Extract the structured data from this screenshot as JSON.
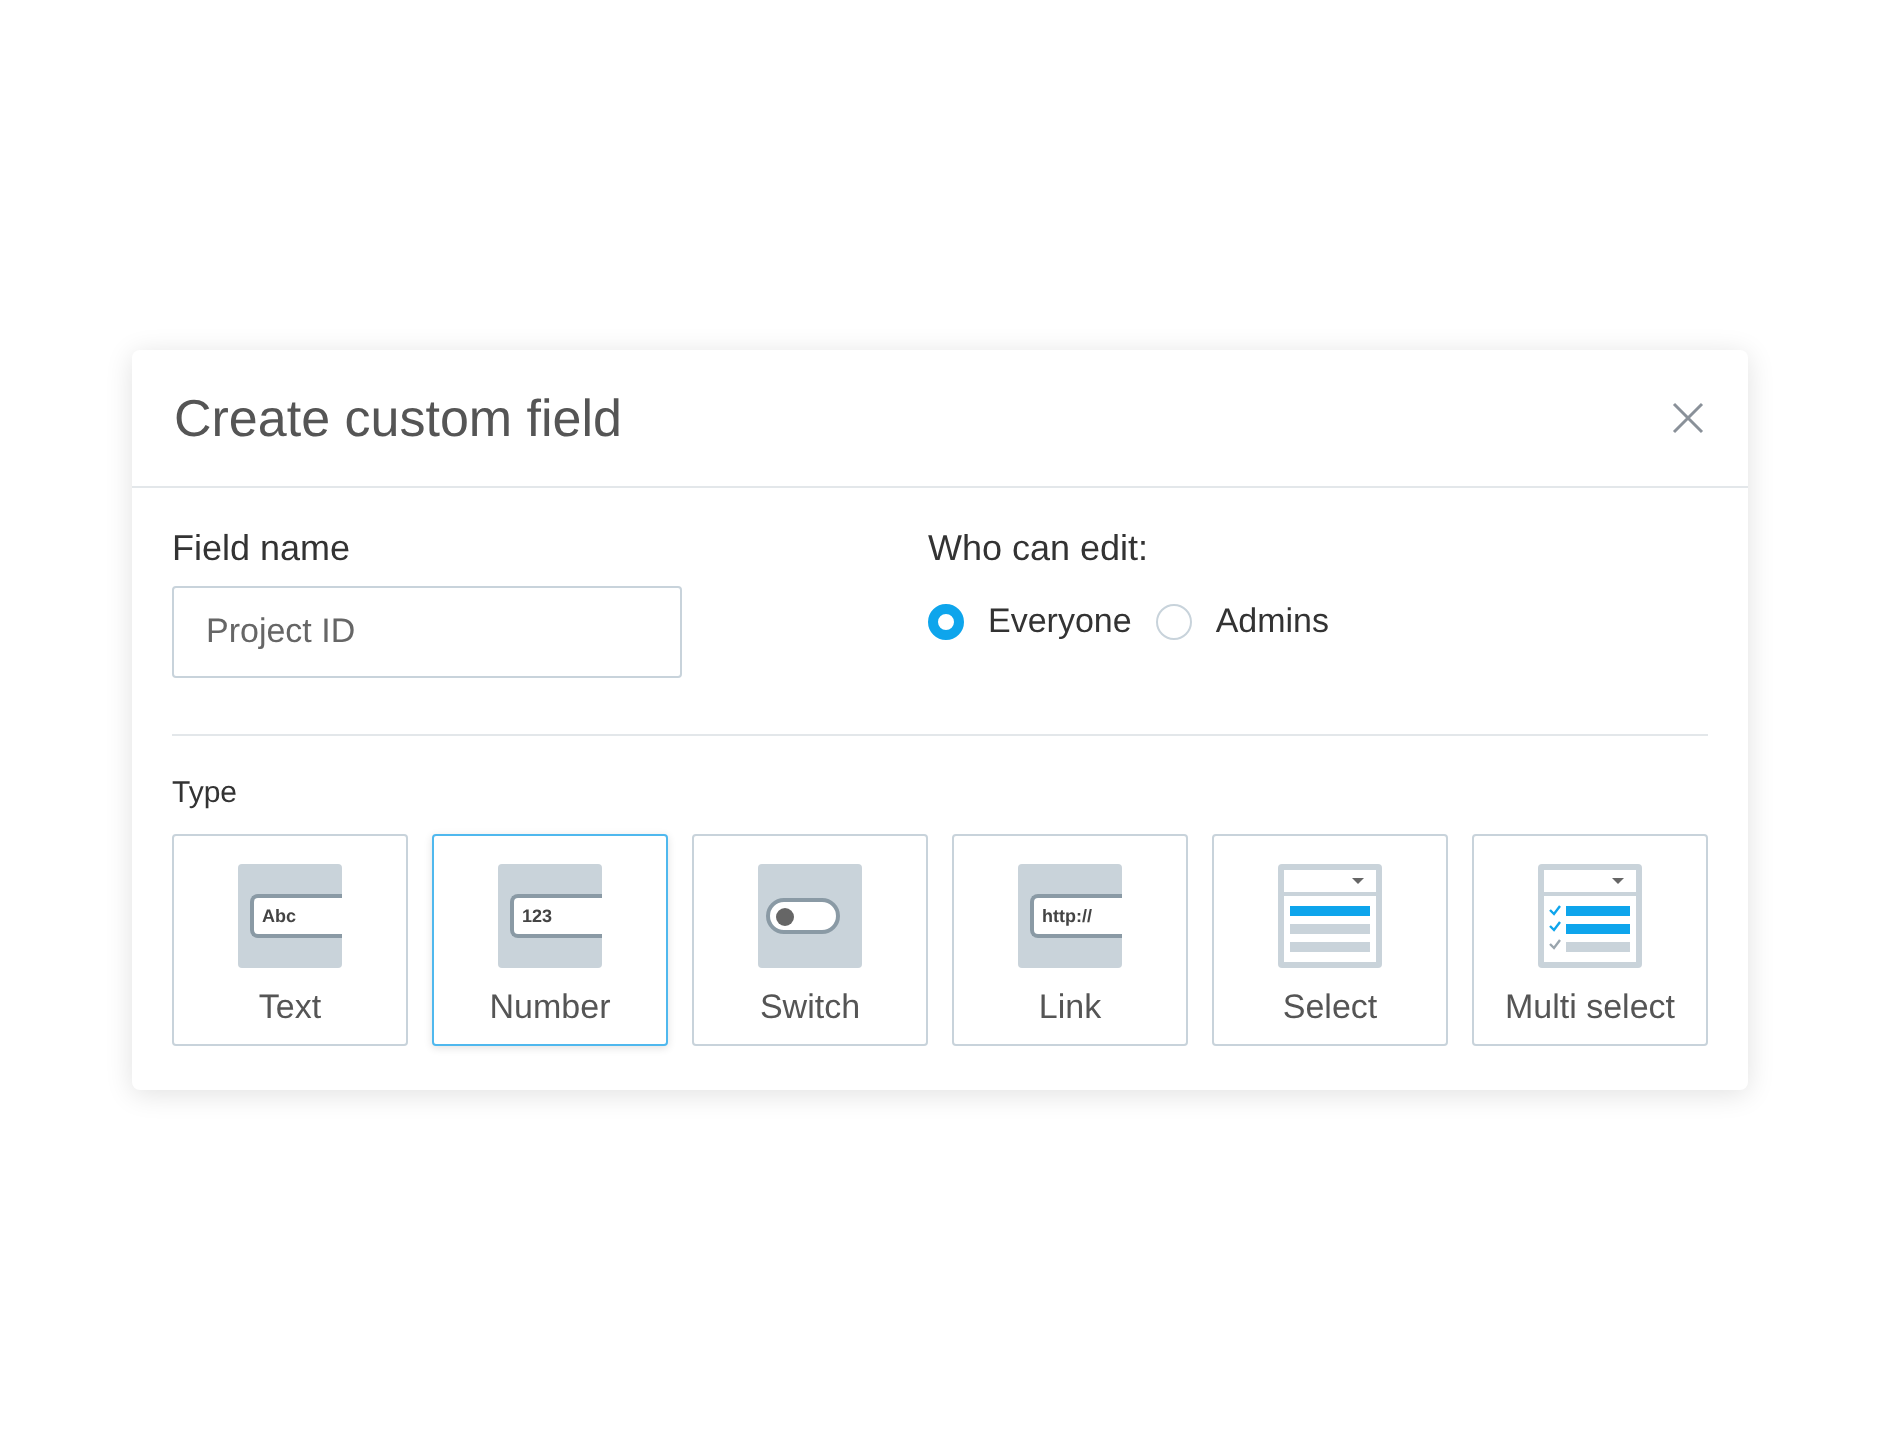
{
  "dialog": {
    "title": "Create custom field"
  },
  "field_name": {
    "label": "Field name",
    "value": "Project ID"
  },
  "who_can_edit": {
    "label": "Who can edit:",
    "options": [
      {
        "label": "Everyone",
        "selected": true
      },
      {
        "label": "Admins",
        "selected": false
      }
    ]
  },
  "type": {
    "label": "Type",
    "options": [
      {
        "kind": "text",
        "icon_text": "Abc",
        "label": "Text",
        "selected": false
      },
      {
        "kind": "text",
        "icon_text": "123",
        "label": "Number",
        "selected": true
      },
      {
        "kind": "switch",
        "label": "Switch",
        "selected": false
      },
      {
        "kind": "text",
        "icon_text": "http://",
        "label": "Link",
        "selected": false
      },
      {
        "kind": "select",
        "label": "Select",
        "selected": false
      },
      {
        "kind": "multiselect",
        "label": "Multi select",
        "selected": false
      }
    ]
  }
}
